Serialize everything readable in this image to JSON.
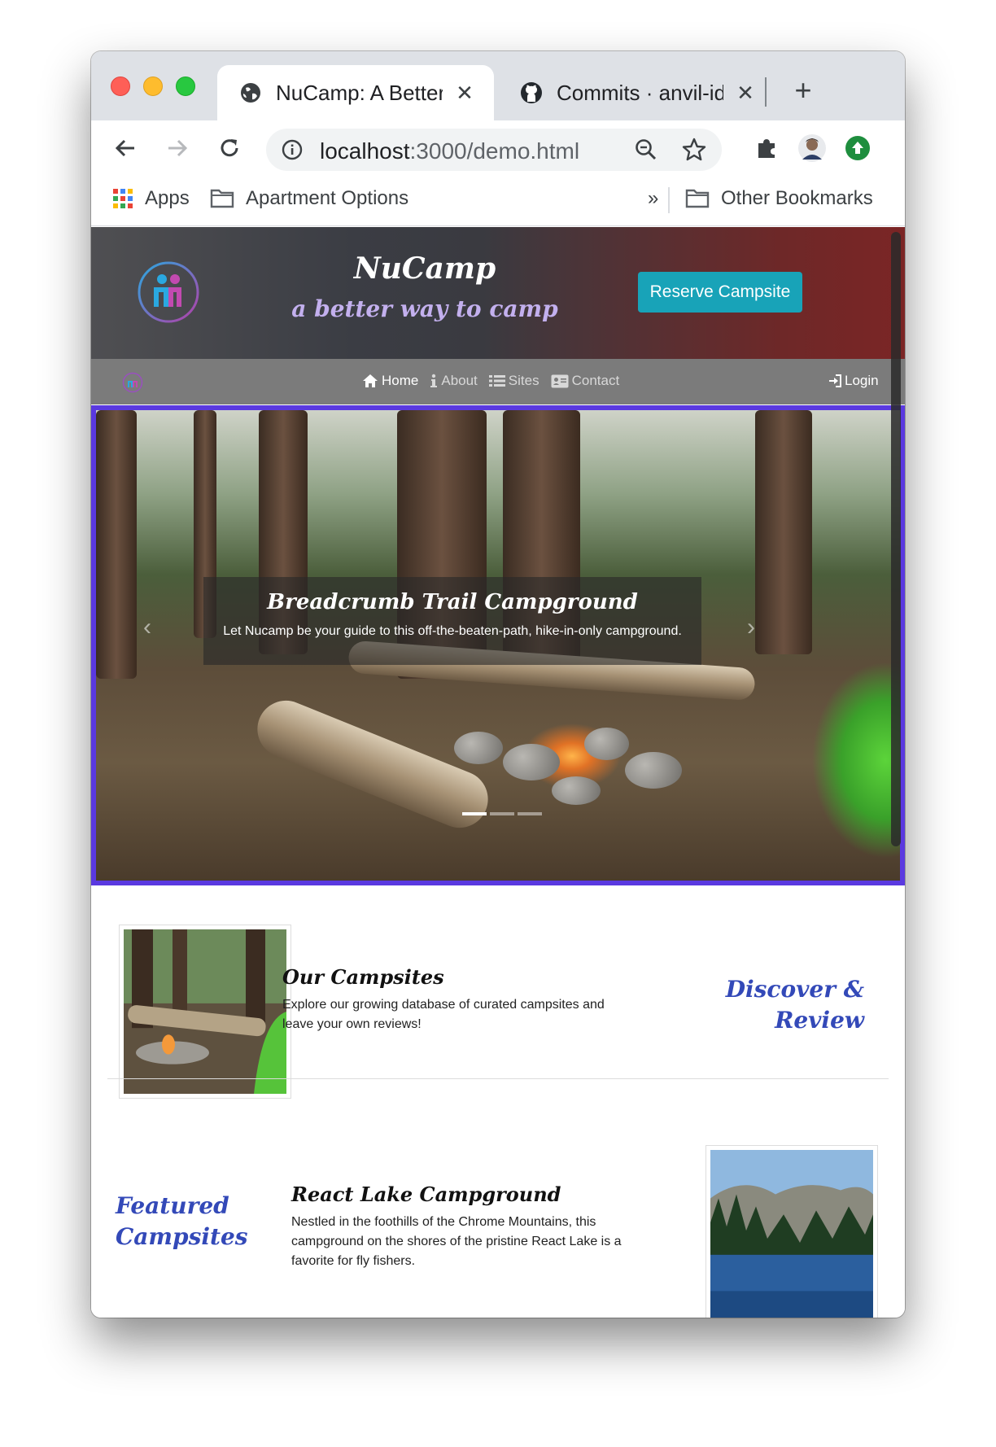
{
  "browser": {
    "tabs": [
      {
        "title": "NuCamp: A Better",
        "active": true,
        "icon": "globe-icon"
      },
      {
        "title": "Commits · anvil-id",
        "active": false,
        "icon": "github-icon"
      }
    ],
    "close_glyph": "✕",
    "new_tab_glyph": "+",
    "url_host": "localhost",
    "url_path": ":3000/demo.html",
    "bookmarks": {
      "apps": "Apps",
      "folder1": "Apartment Options",
      "overflow": "»",
      "other": "Other Bookmarks"
    }
  },
  "site": {
    "brand": "NuCamp",
    "tagline": "a better way to camp",
    "reserve_button": "Reserve Campsite",
    "nav": [
      {
        "label": "Home",
        "icon": "home-icon",
        "active": true
      },
      {
        "label": "About",
        "icon": "info-icon",
        "active": false
      },
      {
        "label": "Sites",
        "icon": "list-icon",
        "active": false
      },
      {
        "label": "Contact",
        "icon": "address-card-icon",
        "active": false
      }
    ],
    "login": "Login",
    "carousel": {
      "title": "Breadcrumb Trail Campground",
      "text": "Let Nucamp be your guide to this off-the-beaten-path, hike-in-only campground.",
      "prev_glyph": "‹",
      "next_glyph": "›",
      "slides": 3,
      "active_slide": 1
    },
    "campsites": {
      "title": "Our Campsites",
      "text": "Explore our growing database of curated campsites and leave your own reviews!",
      "accent_line1": "Discover &",
      "accent_line2": "Review"
    },
    "featured": {
      "accent_line1": "Featured",
      "accent_line2": "Campsites",
      "title": "React Lake Campground",
      "text": "Nestled in the foothills of the Chrome Mountains, this campground on the shores of the pristine React Lake is a favorite for fly fishers."
    }
  },
  "colors": {
    "accent_border": "#5a39e0",
    "reserve_button": "#18a3b8",
    "accent_text": "#3349b8"
  }
}
